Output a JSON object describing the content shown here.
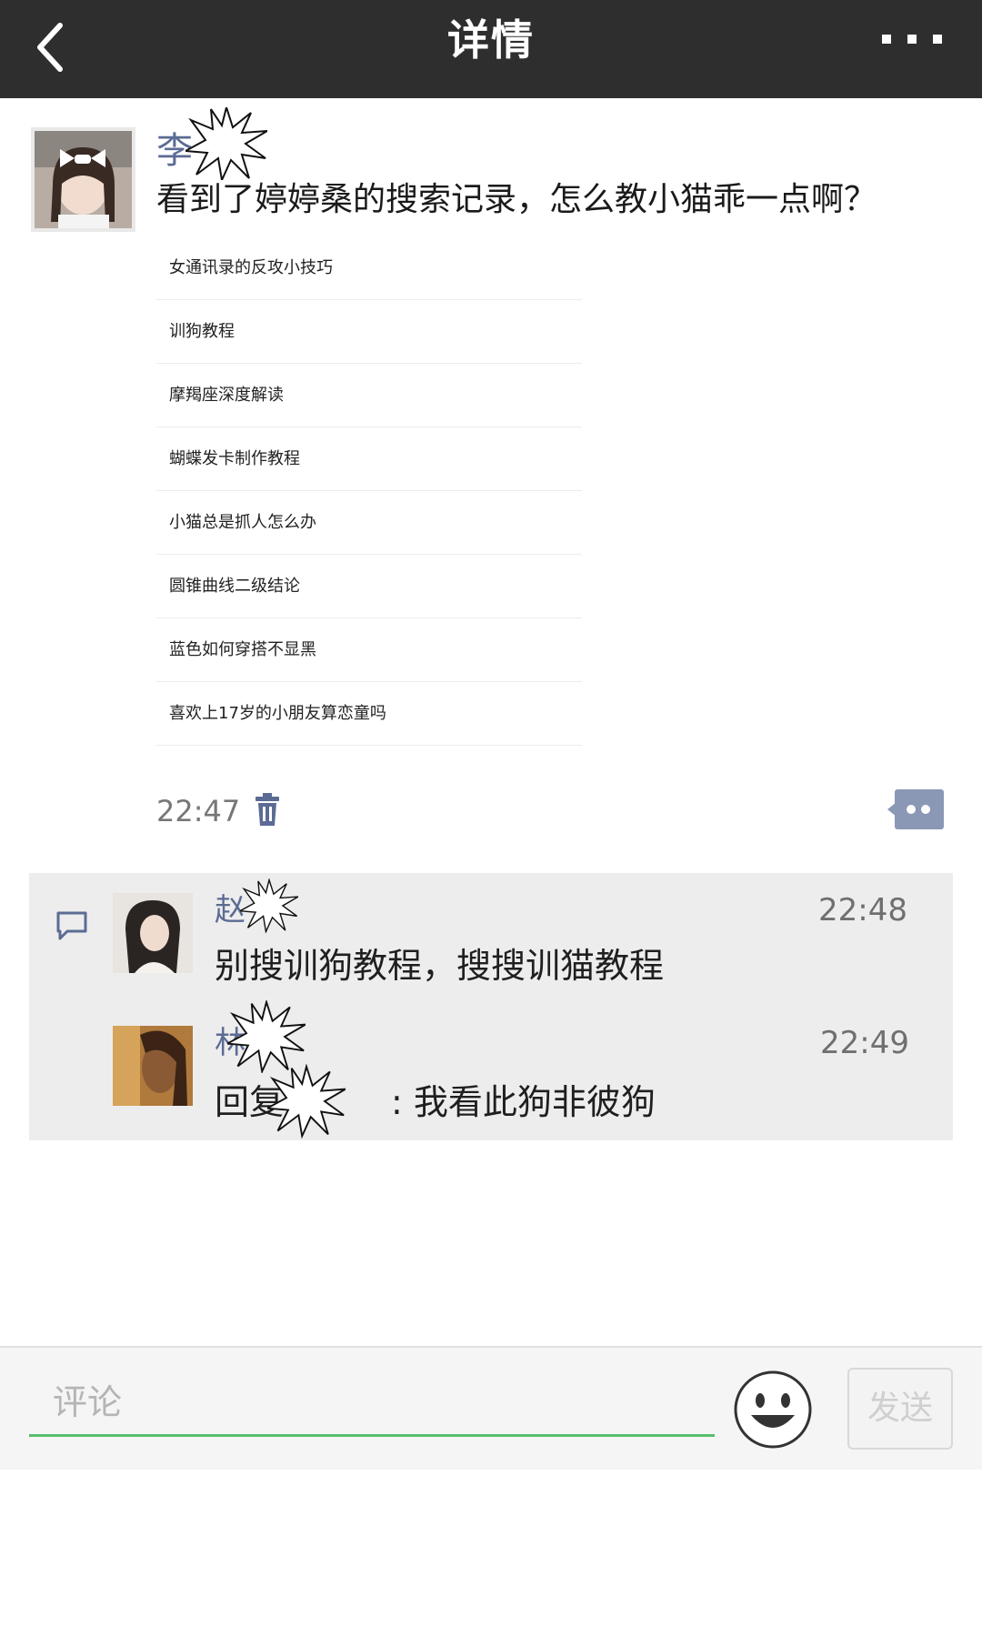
{
  "header": {
    "title": "详情",
    "back_icon": "chevron-left-icon",
    "more_icon": "more-dots-icon"
  },
  "post": {
    "author": "李",
    "text": "看到了婷婷桑的搜索记录，怎么教小猫乖一点啊？",
    "search_history": [
      "女通讯录的反攻小技巧",
      "训狗教程",
      "摩羯座深度解读",
      "蝴蝶发卡制作教程",
      "小猫总是抓人怎么办",
      "圆锥曲线二级结论",
      "蓝色如何穿搭不显黑",
      "喜欢上17岁的小朋友算恋童吗"
    ],
    "time": "22:47"
  },
  "comments": [
    {
      "name": "赵",
      "time": "22:48",
      "text": "别搜训狗教程，搜搜训猫教程"
    },
    {
      "name": "林",
      "time": "22:49",
      "text_prefix": "回复",
      "text": ": 我看此狗非彼狗"
    }
  ],
  "composer": {
    "placeholder": "评论",
    "send_label": "发送"
  },
  "colors": {
    "header_bg": "#2e2e2e",
    "name_color": "#5b6b94",
    "input_underline": "#57be6a",
    "comment_bg": "#ededed"
  }
}
